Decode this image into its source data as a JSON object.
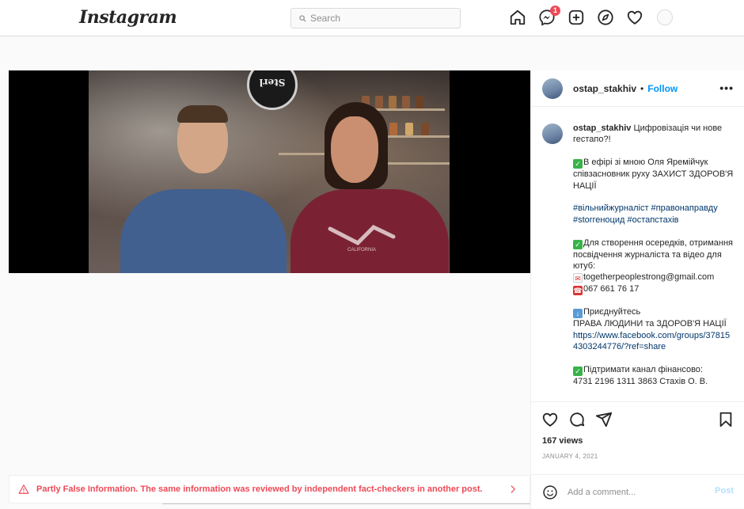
{
  "nav": {
    "logo": "Instagram",
    "search_placeholder": "Search",
    "messages_badge": "1",
    "icons": [
      "home-icon",
      "messenger-icon",
      "new-post-icon",
      "explore-icon",
      "activity-heart-icon",
      "profile-avatar"
    ]
  },
  "post": {
    "username": "ostap_stakhiv",
    "separator": "•",
    "follow_label": "Follow",
    "more_label": "•••",
    "caption": {
      "username": "ostap_stakhiv",
      "title": "Цифровізація чи нове гестапо?!",
      "intro": "В ефірі зі мною Оля Яремійчук співзасновник руху ЗАХИСТ ЗДОРОВ'Я НАЦІЇ",
      "hashtags": "#вільнийжурналіст #правонаправду #storгеноцид #остапстахів",
      "contact_intro": "Для створення осередків, отримання посвідчення журналіста та відео для ютуб:",
      "email": "togetherpeoplestrong@gmail.com",
      "phone": "067 661 76 17",
      "join_label": "Приєднуйтесь",
      "group_name": "ПРАВА ЛЮДИНИ та ЗДОРОВ'Я НАЦІЇ",
      "group_link": "https://www.facebook.com/groups/378154303244776/?ref=share",
      "support_label": "Підтримати канал фінансово:",
      "card": "4731 2196 1311 3863 Стахів О. В."
    },
    "views": "167 views",
    "date": "JANUARY 4, 2021",
    "comment_placeholder": "Add a comment...",
    "post_label": "Post"
  },
  "media": {
    "sign_text": "Sterl Coffee",
    "hoodie_text": "CALIFORNIA"
  },
  "fact_check": {
    "text": "Partly False Information. The same information was reviewed by independent fact-checkers in another post."
  },
  "colors": {
    "accent_blue": "#0095f6",
    "warning_red": "#ed4956",
    "border": "#dbdbdb"
  }
}
